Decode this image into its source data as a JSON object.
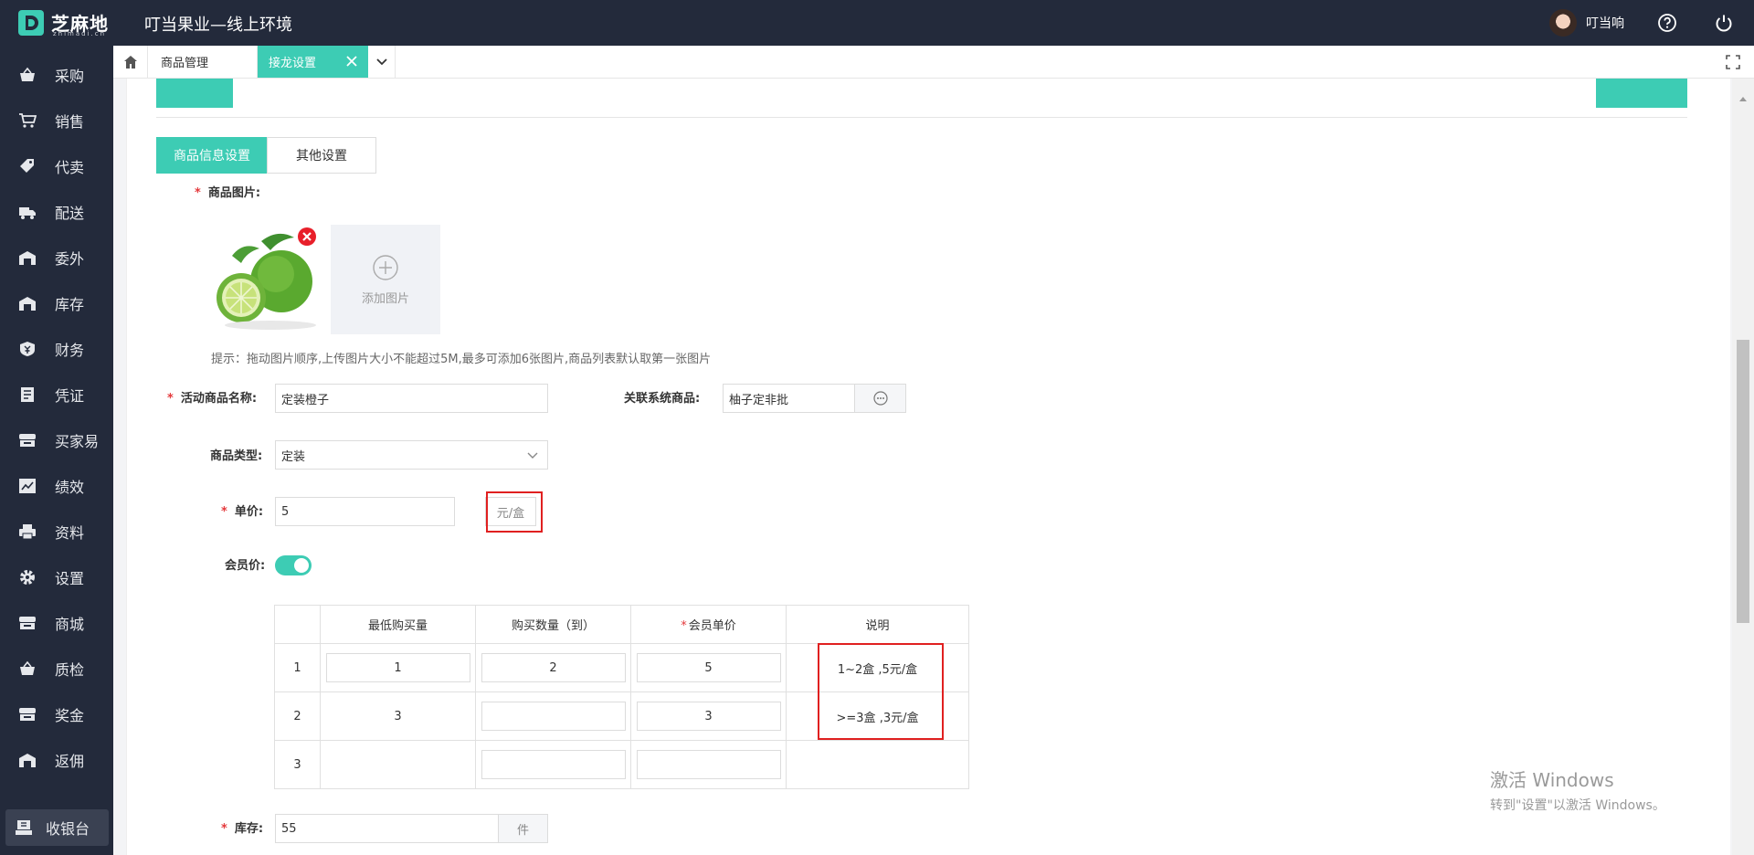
{
  "header": {
    "logo_text": "芝麻地",
    "logo_sub": "zhimadi.cn",
    "app_title": "叮当果业—线上环境",
    "user_name": "叮当响"
  },
  "sidebar": {
    "items": [
      {
        "label": "采购",
        "icon": "basket-icon"
      },
      {
        "label": "销售",
        "icon": "cart-icon"
      },
      {
        "label": "代卖",
        "icon": "tag-icon"
      },
      {
        "label": "配送",
        "icon": "truck-icon"
      },
      {
        "label": "委外",
        "icon": "warehouse-icon"
      },
      {
        "label": "库存",
        "icon": "warehouse-icon"
      },
      {
        "label": "财务",
        "icon": "finance-icon"
      },
      {
        "label": "凭证",
        "icon": "voucher-icon"
      },
      {
        "label": "买家易",
        "icon": "store-icon"
      },
      {
        "label": "绩效",
        "icon": "chart-icon"
      },
      {
        "label": "资料",
        "icon": "printer-icon"
      },
      {
        "label": "设置",
        "icon": "gear-icon"
      },
      {
        "label": "商城",
        "icon": "store-icon"
      },
      {
        "label": "质检",
        "icon": "basket-icon"
      },
      {
        "label": "奖金",
        "icon": "store-icon"
      },
      {
        "label": "返佣",
        "icon": "warehouse-icon"
      }
    ],
    "cashier_label": "收银台"
  },
  "tabs": [
    {
      "label": "商品管理"
    },
    {
      "label": "接龙设置"
    }
  ],
  "subtabs": {
    "active": "商品信息设置",
    "other": "其他设置"
  },
  "form": {
    "image_label": "商品图片:",
    "add_image": "添加图片",
    "hint": "提示：拖动图片顺序,上传图片大小不能超过5M,最多可添加6张图片,商品列表默认取第一张图片",
    "name_label": "活动商品名称:",
    "name_value": "定装橙子",
    "linked_label": "关联系统商品:",
    "linked_value": "柚子定非批",
    "type_label": "商品类型:",
    "type_value": "定装",
    "price_label": "单价:",
    "price_value": "5",
    "price_unit": "元/盒",
    "member_label": "会员价:",
    "member_enabled": true,
    "stock_label": "库存:",
    "stock_value": "55",
    "stock_unit": "件"
  },
  "tier_table": {
    "headers": [
      "",
      "最低购买量",
      "购买数量（到）",
      "会员单价",
      "说明"
    ],
    "rows": [
      {
        "index": "1",
        "min": "1",
        "to": "2",
        "price": "5",
        "desc": "1~2盒 ,5元/盒"
      },
      {
        "index": "2",
        "min": "3",
        "to": "",
        "price": "3",
        "desc": ">=3盒 ,3元/盒"
      },
      {
        "index": "3",
        "min": "",
        "to": "",
        "price": "",
        "desc": ""
      }
    ]
  },
  "watermark": {
    "line1": "激活 Windows",
    "line2": "转到\"设置\"以激活 Windows。"
  },
  "colors": {
    "accent": "#3dccb4",
    "nav_bg": "#232a3b",
    "highlight": "#e02020"
  }
}
